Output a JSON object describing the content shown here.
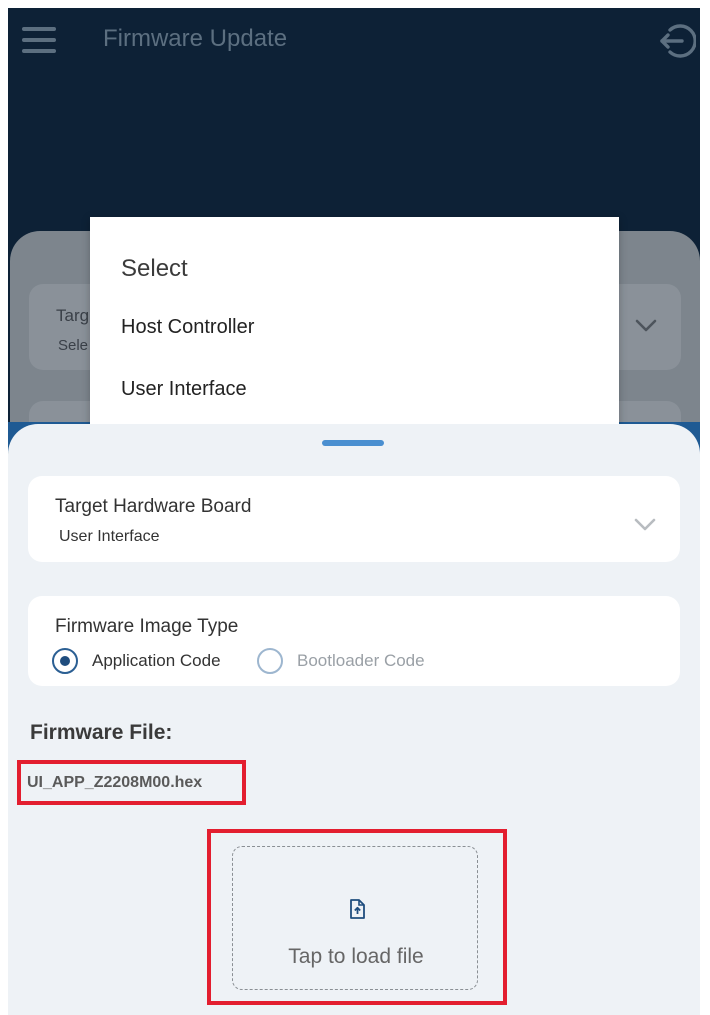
{
  "appbar": {
    "title": "Firmware Update"
  },
  "background": {
    "label": "Targ",
    "value": "Sele"
  },
  "popup": {
    "title": "Select",
    "options": [
      "Host Controller",
      "User Interface"
    ]
  },
  "board_card": {
    "label": "Target Hardware Board",
    "value": "User Interface"
  },
  "image_type": {
    "label": "Firmware Image Type",
    "options": [
      {
        "label": "Application Code",
        "selected": true
      },
      {
        "label": "Bootloader Code",
        "selected": false
      }
    ]
  },
  "firmware_file": {
    "label": "Firmware File:",
    "name": "UI_APP_Z2208M00.hex"
  },
  "upload": {
    "text": "Tap to load file"
  },
  "colors": {
    "header": "#0d2136",
    "accent": "#1f5a93",
    "highlight": "#e31e2f",
    "sheet": "#eef2f6"
  }
}
